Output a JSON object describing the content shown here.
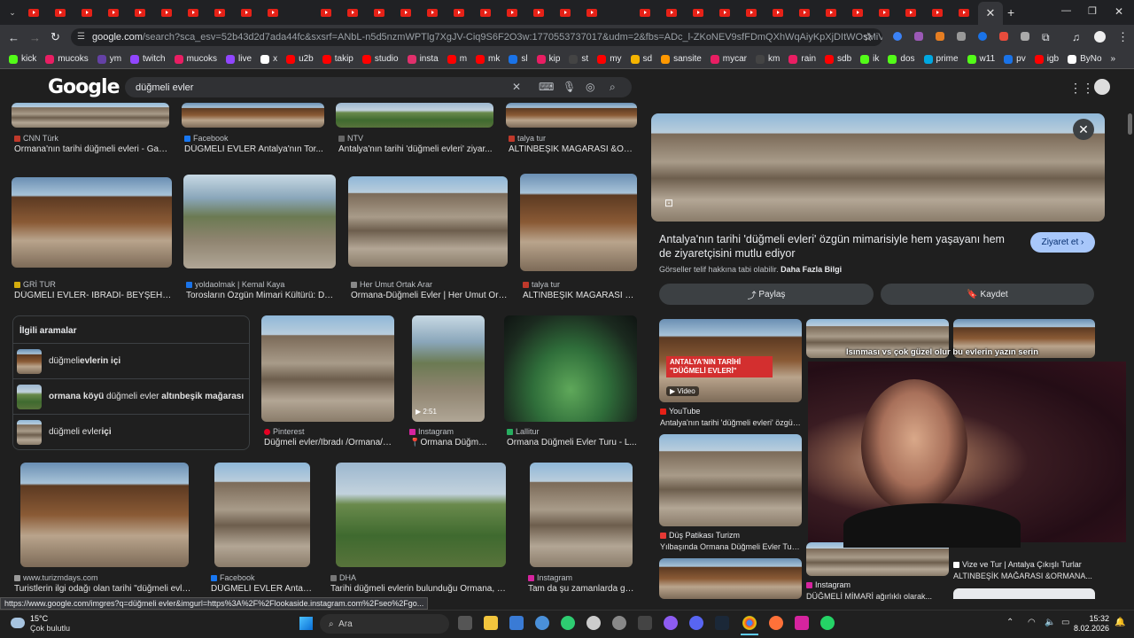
{
  "browser": {
    "url_prefix": "google.com",
    "url_rest": "/search?sca_esv=52b43d2d7ada44fc&sxsrf=ANbL-n5d5nzmWPTlg7XgJV-Ciq9S6F2O3w:1770553737017&udm=2&fbs=ADc_l-ZKoNEV9sfFDmQXhWqAiyKpXjDItWOsMiVMWcA_AtdP-0fZnBrqJA-...",
    "bookmarks": [
      "kick",
      "mucoks",
      "ym",
      "twitch",
      "mucoks",
      "live",
      "x",
      "u2b",
      "takip",
      "studio",
      "insta",
      "m",
      "mk",
      "sl",
      "kip",
      "st",
      "my",
      "sd",
      "sansite",
      "mycar",
      "km",
      "rain",
      "sdb",
      "ik",
      "dos",
      "prime",
      "w11",
      "pv",
      "igb",
      "ByNo"
    ],
    "status_url": "https://www.google.com/imgres?q=düğmeli evler&imgurl=https%3A%2F%2Flookaside.instagram.com%2Fseo%2Fgo..."
  },
  "search": {
    "query": "düğmeli evler",
    "logo": "Google"
  },
  "results_row1": [
    {
      "source": "CNN Türk",
      "title": "Ormana'nın tarihi düğmeli evleri - Gaz..."
    },
    {
      "source": "Facebook",
      "title": "DÜĞMELİ EVLER Antalya'nın Tor..."
    },
    {
      "source": "NTV",
      "title": "Antalya'nın tarihi 'düğmeli evleri' ziyar..."
    },
    {
      "source": "talya tur",
      "title": "ALTINBEŞİK MAĞARASI &OR..."
    }
  ],
  "results_row2": [
    {
      "source": "GRİ TUR",
      "title": "DÜĞMELİ EVLER- İBRADİ- BEYŞEHİ..."
    },
    {
      "source": "yoldaolmak | Kemal Kaya",
      "title": "Torosların Özgün Mimari Kültürü: Dü..."
    },
    {
      "source": "Her Umut Ortak Arar",
      "title": "Ormana-Düğmeli Evler | Her Umut Ort..."
    },
    {
      "source": "talya tur",
      "title": "ALTINBEŞİK MAĞARASI &..."
    }
  ],
  "related": {
    "title": "İlgili aramalar",
    "items": [
      {
        "pre": "düğmeli ",
        "bold": "evlerin içi",
        "post": ""
      },
      {
        "pre": "",
        "bold": "ormana köyü",
        "post": " düğmeli evler ",
        "bold2": "altınbeşik mağarası"
      },
      {
        "pre": "düğmeli evler ",
        "bold": "içi",
        "post": ""
      }
    ]
  },
  "results_row3": [
    {
      "source": "Pinterest",
      "title": "Düğmeli evler/İbradı /Ormana/A..."
    },
    {
      "source": "Instagram",
      "title": "📍Ormana Düğme...",
      "badge": "2:51"
    },
    {
      "source": "Lallitur",
      "title": "Ormana Düğmeli Evler Turu - L..."
    }
  ],
  "results_row4": [
    {
      "source": "www.turizmdays.com",
      "title": "Turistlerin ilgi odağı olan tarihi \"düğmeli evler..."
    },
    {
      "source": "Facebook",
      "title": "DÜĞMELİ EVLER Antaly..."
    },
    {
      "source": "DHA",
      "title": "Tarihi düğmeli evlerin bulunduğu Ormana, dü..."
    },
    {
      "source": "Instagram",
      "title": "Tam da şu zamanlarda ge..."
    }
  ],
  "panel": {
    "title": "Antalya'nın tarihi 'düğmeli evleri' özgün mimarisiyle hem yaşayanı hem de ziyaretçisini mutlu ediyor",
    "visit": "Ziyaret et",
    "copyright": "Görseller telif hakkına tabi olabilir.",
    "more": "Daha Fazla Bilgi",
    "share": "Paylaş",
    "save": "Kaydet",
    "video_overlay": "ANTALYA'NIN TARİHİ \"DÜĞMELİ EVLERİ\"",
    "video_badge": "Video",
    "subtitle_overlay": "Isınması vs çok güzel olur bu evlerin yazın serin",
    "related": [
      {
        "source": "YouTube",
        "title": "Antalya'nın tarihi 'düğmeli evleri' özgün..."
      },
      {
        "source": "Düş Patikası Turizm",
        "title": "Yılbaşında Ormana Düğmeli Evler Turu |..."
      },
      {
        "source": "Vize ve Tur | Antalya Çıkışlı Turlar",
        "title": "ALTINBEŞİK MAĞARASI &ORMANA..."
      },
      {
        "source": "Instagram",
        "title": "DÜĞMELİ MİMARİ ağırlıklı olarak..."
      }
    ]
  },
  "taskbar": {
    "weather_temp": "15°C",
    "weather_text": "Çok bulutlu",
    "search": "Ara",
    "time": "15:32",
    "date": "8.02.2026"
  }
}
